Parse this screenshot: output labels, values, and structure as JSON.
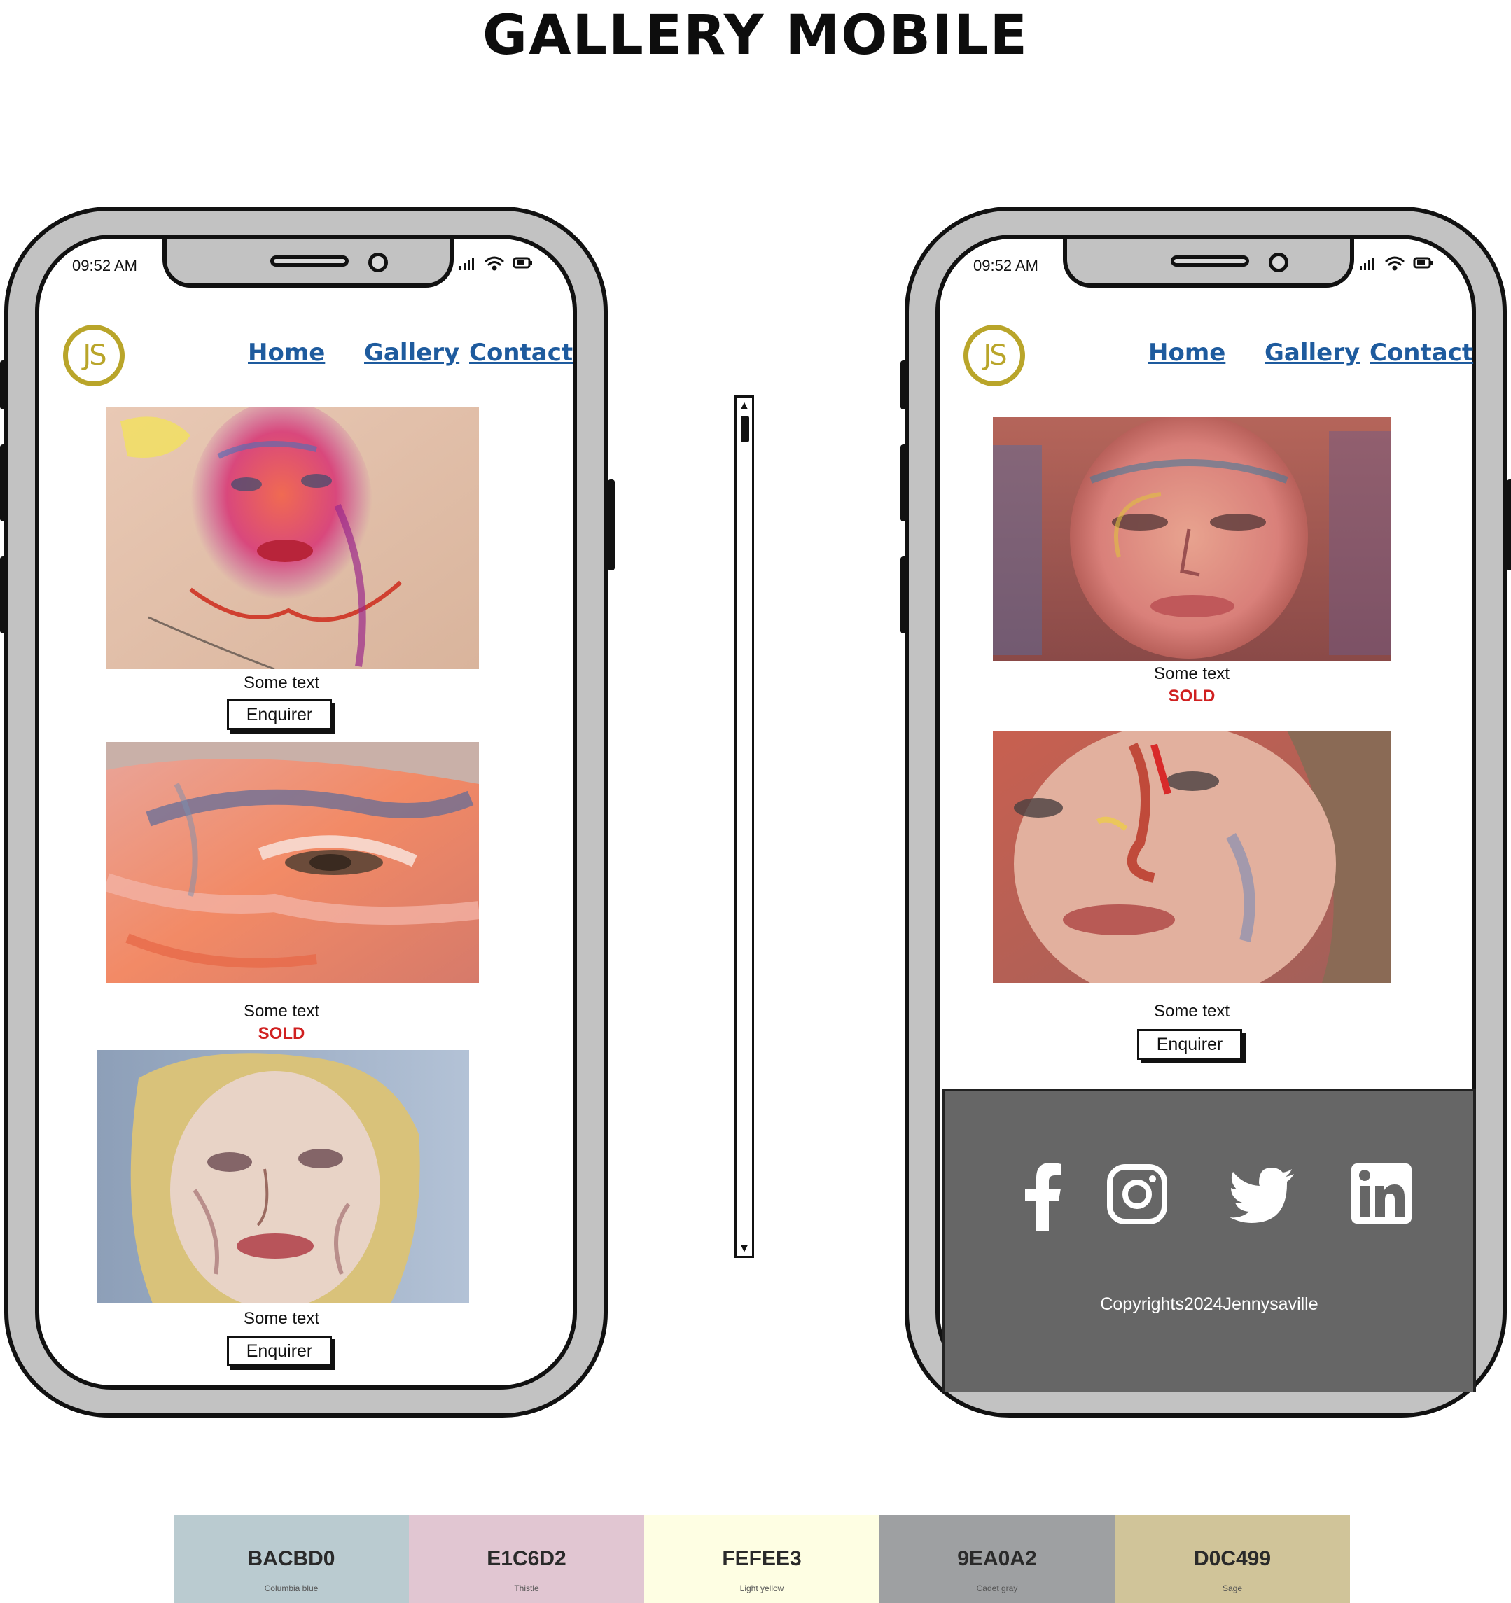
{
  "title": "GALLERY MOBILE",
  "status_time": "09:52 AM",
  "logo_text": "JS",
  "nav": {
    "home": "Home",
    "gallery": "Gallery",
    "contact": "Contact"
  },
  "left_phone": {
    "items": [
      {
        "caption": "Some text",
        "enquire_label": "Enquirer"
      },
      {
        "caption": "Some text",
        "sold_label": "SOLD"
      },
      {
        "caption": "Some text",
        "enquire_label": "Enquirer"
      }
    ]
  },
  "right_phone": {
    "items": [
      {
        "caption": "Some text",
        "sold_label": "SOLD"
      },
      {
        "caption": "Some text",
        "enquire_label": "Enquirer"
      }
    ],
    "footer": {
      "social_icons": [
        "facebook-icon",
        "instagram-icon",
        "twitter-icon",
        "linkedin-icon"
      ],
      "copyright": "Copyrights2024Jennysaville"
    }
  },
  "palette": [
    {
      "hex": "BACBD0",
      "name": "Columbia blue",
      "color": "#BACBD0"
    },
    {
      "hex": "E1C6D2",
      "name": "Thistle",
      "color": "#E1C6D2"
    },
    {
      "hex": "FEFEE3",
      "name": "Light yellow",
      "color": "#FEFEE3"
    },
    {
      "hex": "9EA0A2",
      "name": "Cadet gray",
      "color": "#9EA0A2"
    },
    {
      "hex": "D0C499",
      "name": "Sage",
      "color": "#D0C499"
    }
  ],
  "colors": {
    "nav_link": "#1e5b9e",
    "logo": "#b9a52a",
    "sold": "#d02020",
    "footer_bg": "#666666"
  }
}
